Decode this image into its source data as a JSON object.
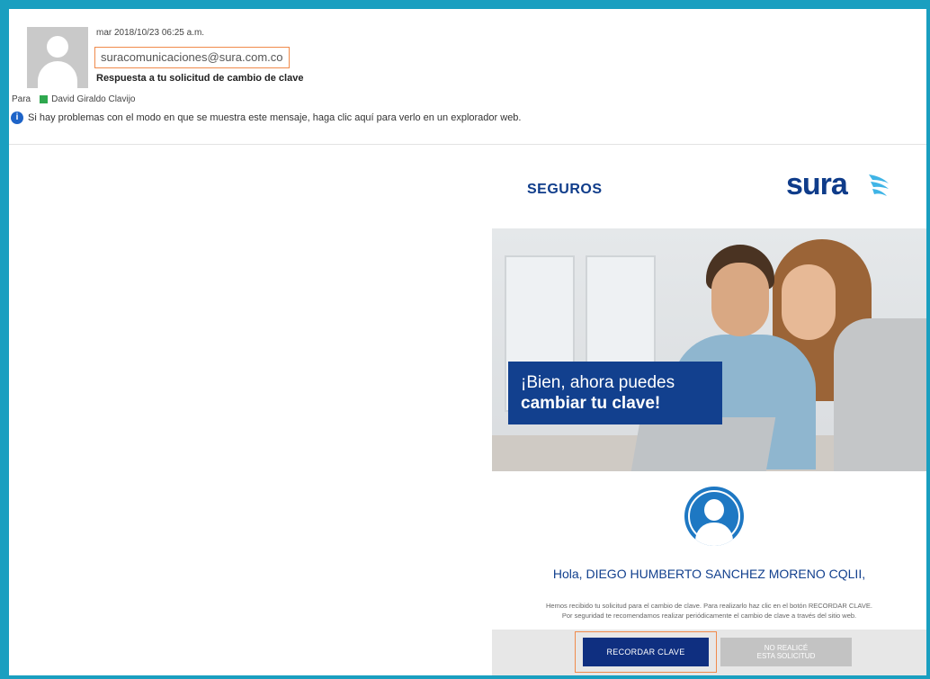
{
  "message": {
    "date": "mar 2018/10/23 06:25 a.m.",
    "from": "suracomunicaciones@sura.com.co",
    "subject": "Respuesta a tu solicitud de cambio de clave",
    "to_label": "Para",
    "to_name": "David Giraldo Clavijo",
    "info_icon": "i",
    "info_text": "Si hay problemas con el modo en que se muestra este mensaje, haga clic aquí para verlo en un explorador web."
  },
  "email": {
    "seguros_label": "SEGUROS",
    "logo_text": "sura",
    "hero_line1": "¡Bien, ahora puedes",
    "hero_line2": "cambiar tu clave!",
    "greeting": "Hola, DIEGO HUMBERTO SANCHEZ MORENO CQLII,",
    "body_line1": "Hemos recibido tu solicitud para el cambio de clave. Para realizarlo haz clic en el botón RECORDAR CLAVE.",
    "body_line2": "Por seguridad te recomendamos realizar periódicamente el cambio de clave a través del sitio web.",
    "button_recordar": "RECORDAR CLAVE",
    "button_no_line1": "NO REALICÉ",
    "button_no_line2": "ESTA SOLICITUD"
  },
  "colors": {
    "frame": "#1a9fc0",
    "brand_blue": "#0f3c8a",
    "highlight_outline": "#f08a4b",
    "contact_status": "#2fa84f"
  }
}
